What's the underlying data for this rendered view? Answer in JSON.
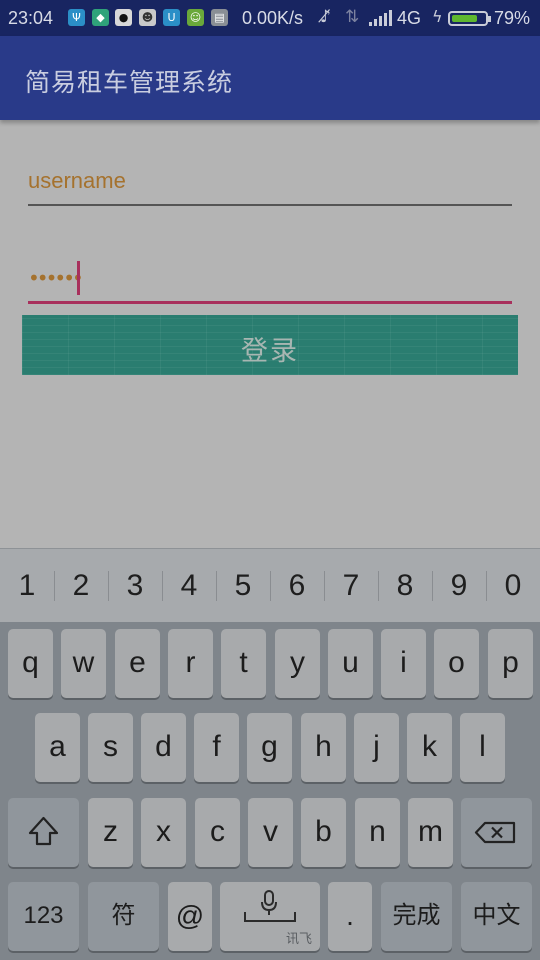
{
  "status_bar": {
    "time": "23:04",
    "speed": "0.00K/s",
    "network": "4G",
    "battery_percent": "79%",
    "battery_level": 0.79,
    "icons": [
      "usb-icon",
      "shield-icon",
      "qq-icon",
      "avatar-app-icon",
      "app-notification-icon",
      "android-icon",
      "message-icon",
      "mute-icon",
      "data-arrows-icon",
      "signal-icon",
      "charging-icon",
      "battery-icon"
    ]
  },
  "app_bar": {
    "title": "简易租车管理系统"
  },
  "login_form": {
    "username_hint": "username",
    "password_masked": "••••••",
    "login_label": "登录"
  },
  "keyboard": {
    "number_row": [
      "1",
      "2",
      "3",
      "4",
      "5",
      "6",
      "7",
      "8",
      "9",
      "0"
    ],
    "row1": [
      "q",
      "w",
      "e",
      "r",
      "t",
      "y",
      "u",
      "i",
      "o",
      "p"
    ],
    "row2": [
      "a",
      "s",
      "d",
      "f",
      "g",
      "h",
      "j",
      "k",
      "l"
    ],
    "row3": [
      "z",
      "x",
      "c",
      "v",
      "b",
      "n",
      "m"
    ],
    "key_123": "123",
    "key_symbol": "符",
    "key_at": "@",
    "key_period": ".",
    "key_done": "完成",
    "key_lang": "中文",
    "voice_brand": "讯飞"
  },
  "colors": {
    "status_bar": "#182561",
    "app_bar": "#293a89",
    "accent": "#a8305c",
    "button": "#2a7d70"
  }
}
